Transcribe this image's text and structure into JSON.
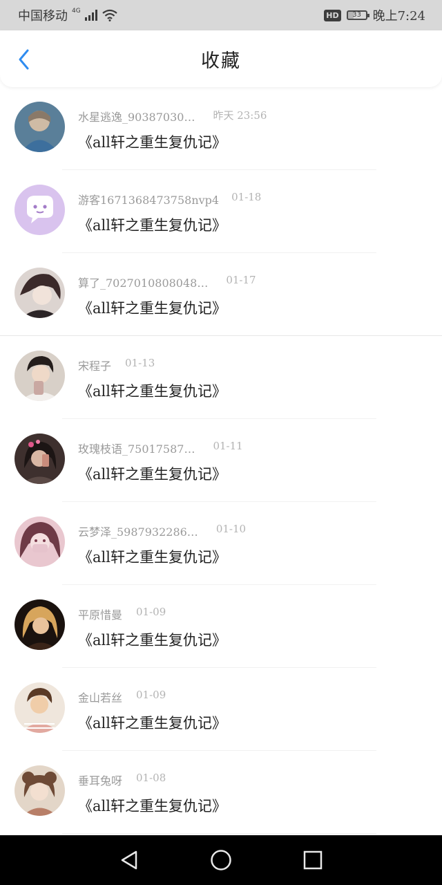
{
  "status_bar": {
    "carrier": "中国移动",
    "network": "4G",
    "hd": "HD",
    "battery": "33",
    "battery_level": 0.33,
    "time": "晚上7:24"
  },
  "header": {
    "title": "收藏"
  },
  "items": [
    {
      "user": "水星逃逸_90387030…",
      "time": "昨天  23:56",
      "book": "《all轩之重生复仇记》",
      "avatar_color": "#6f8fb0"
    },
    {
      "user": "游客1671368473758nvp4",
      "time": "01-18",
      "book": "《all轩之重生复仇记》",
      "avatar_color": "#d9c3ee"
    },
    {
      "user": "算了_7027010808048…",
      "time": "01-17",
      "book": "《all轩之重生复仇记》",
      "avatar_color": "#6a5a5a"
    },
    {
      "user": "宋程子",
      "time": "01-13",
      "book": "《all轩之重生复仇记》",
      "avatar_color": "#b8aca4"
    },
    {
      "user": "玫瑰枝语_75017587…",
      "time": "01-11",
      "book": "《all轩之重生复仇记》",
      "avatar_color": "#7a5650"
    },
    {
      "user": "云梦泽_5987932286…",
      "time": "01-10",
      "book": "《all轩之重生复仇记》",
      "avatar_color": "#d7a4b4"
    },
    {
      "user": "平原惜曼",
      "time": "01-09",
      "book": "《all轩之重生复仇记》",
      "avatar_color": "#2a1a14"
    },
    {
      "user": "金山若丝",
      "time": "01-09",
      "book": "《all轩之重生复仇记》",
      "avatar_color": "#d9c6b2"
    },
    {
      "user": "垂耳兔呀",
      "time": "01-08",
      "book": "《all轩之重生复仇记》",
      "avatar_color": "#c9b09a"
    }
  ],
  "nav": {
    "back": "back-icon",
    "home": "home-icon",
    "recent": "recent-apps-icon"
  },
  "colors": {
    "accent": "#2f8cf0",
    "status_bg": "#d8d8d8"
  }
}
